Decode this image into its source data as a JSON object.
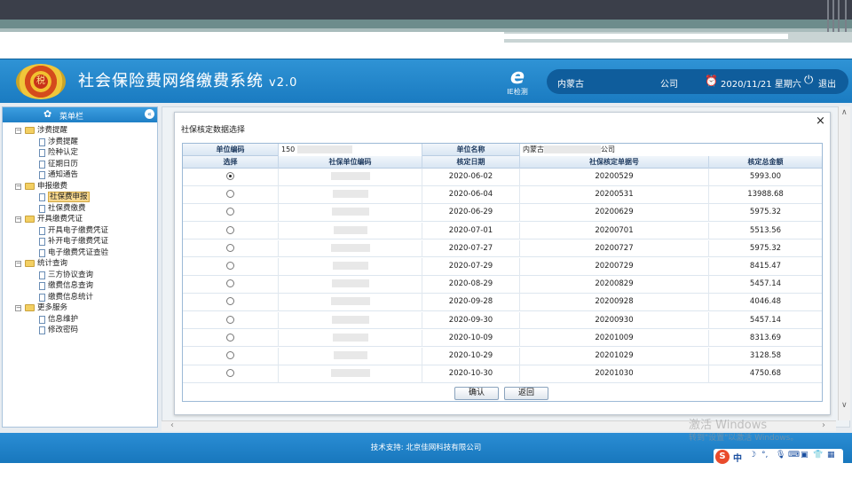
{
  "header": {
    "title": "社会保险费网络缴费系统",
    "version": "v2.0",
    "ie_check_label": "IE检测",
    "province": "内蒙古",
    "company": "公司",
    "datetime": "2020/11/21 星期六",
    "logout": "退出"
  },
  "sidebar": {
    "title": "菜单栏",
    "items": [
      {
        "label": "涉费提醒",
        "type": "folder",
        "level": 0
      },
      {
        "label": "涉费提醒",
        "type": "doc",
        "level": 1
      },
      {
        "label": "险种认定",
        "type": "doc",
        "level": 1
      },
      {
        "label": "征期日历",
        "type": "doc",
        "level": 1
      },
      {
        "label": "通知通告",
        "type": "doc",
        "level": 1
      },
      {
        "label": "申报缴费",
        "type": "folder",
        "level": 0
      },
      {
        "label": "社保费申报",
        "type": "doc",
        "level": 1,
        "selected": true
      },
      {
        "label": "社保费缴费",
        "type": "doc",
        "level": 1
      },
      {
        "label": "开具缴费凭证",
        "type": "folder",
        "level": 0
      },
      {
        "label": "开具电子缴费凭证",
        "type": "doc",
        "level": 1
      },
      {
        "label": "补开电子缴费凭证",
        "type": "doc",
        "level": 1
      },
      {
        "label": "电子缴费凭证查验",
        "type": "doc",
        "level": 1
      },
      {
        "label": "统计查询",
        "type": "folder",
        "level": 0
      },
      {
        "label": "三方协议查询",
        "type": "doc",
        "level": 1
      },
      {
        "label": "缴费信息查询",
        "type": "doc",
        "level": 1
      },
      {
        "label": "缴费信息统计",
        "type": "doc",
        "level": 1
      },
      {
        "label": "更多服务",
        "type": "folder",
        "level": 0
      },
      {
        "label": "信息维护",
        "type": "doc",
        "level": 1
      },
      {
        "label": "修改密码",
        "type": "doc",
        "level": 1
      }
    ]
  },
  "dialog": {
    "title": "社保核定数据选择",
    "close": "×",
    "info": {
      "unit_code_label": "单位编码",
      "unit_code_value": "150",
      "unit_name_label": "单位名称",
      "unit_name_prefix": "内蒙古",
      "unit_name_suffix": "公司"
    },
    "columns": [
      "选择",
      "社保单位编码",
      "核定日期",
      "社保核定单据号",
      "核定总金额"
    ],
    "rows": [
      {
        "selected": true,
        "date": "2020-06-02",
        "doc_no": "20200529",
        "amount": "5993.00"
      },
      {
        "selected": false,
        "date": "2020-06-04",
        "doc_no": "20200531",
        "amount": "13988.68"
      },
      {
        "selected": false,
        "date": "2020-06-29",
        "doc_no": "20200629",
        "amount": "5975.32"
      },
      {
        "selected": false,
        "date": "2020-07-01",
        "doc_no": "20200701",
        "amount": "5513.56"
      },
      {
        "selected": false,
        "date": "2020-07-27",
        "doc_no": "20200727",
        "amount": "5975.32"
      },
      {
        "selected": false,
        "date": "2020-07-29",
        "doc_no": "20200729",
        "amount": "8415.47"
      },
      {
        "selected": false,
        "date": "2020-08-29",
        "doc_no": "20200829",
        "amount": "5457.14"
      },
      {
        "selected": false,
        "date": "2020-09-28",
        "doc_no": "20200928",
        "amount": "4046.48"
      },
      {
        "selected": false,
        "date": "2020-09-30",
        "doc_no": "20200930",
        "amount": "5457.14"
      },
      {
        "selected": false,
        "date": "2020-10-09",
        "doc_no": "20201009",
        "amount": "8313.69"
      },
      {
        "selected": false,
        "date": "2020-10-29",
        "doc_no": "20201029",
        "amount": "3128.58"
      },
      {
        "selected": false,
        "date": "2020-10-30",
        "doc_no": "20201030",
        "amount": "4750.68"
      }
    ],
    "confirm": "确认",
    "back": "返回"
  },
  "footer": {
    "support": "技术支持: 北京佳网科技有限公司"
  },
  "watermark": {
    "line1": "激活 Windows",
    "line2": "转到\"设置\"以激活 Windows。"
  },
  "ime": {
    "logo": "S",
    "lang": "中"
  },
  "colors": {
    "header_blue": "#1a7bc1",
    "grid_header": "#d9e6f3",
    "selected_menu": "#f7d88f"
  }
}
